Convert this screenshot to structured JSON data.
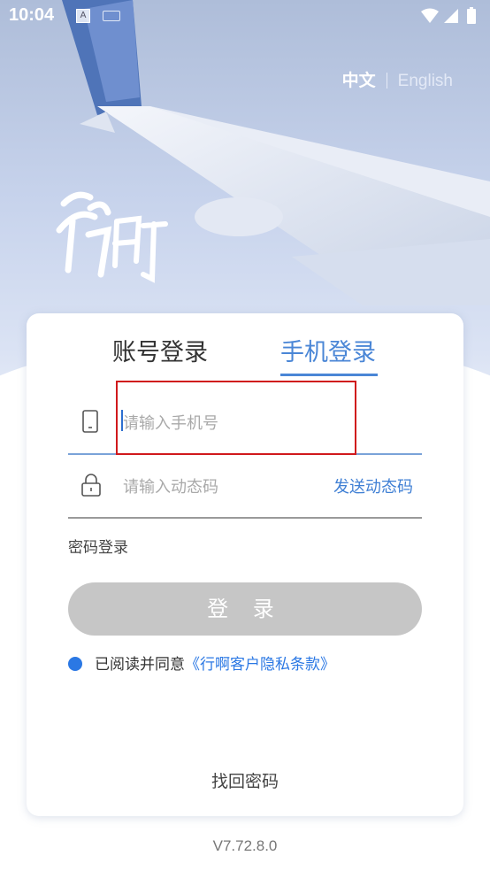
{
  "status_bar": {
    "time": "10:04"
  },
  "brand": {
    "logo_text": "行啊"
  },
  "language": {
    "chinese": "中文",
    "english": "English"
  },
  "tabs": {
    "account_login": "账号登录",
    "phone_login": "手机登录"
  },
  "phone_field": {
    "placeholder": "请输入手机号"
  },
  "code_field": {
    "placeholder": "请输入动态码",
    "send_code": "发送动态码"
  },
  "password_login": "密码登录",
  "login_button": "登 录",
  "agreement": {
    "prefix": "已阅读并同意",
    "link": "《行啊客户隐私条款》"
  },
  "forgot_password": "找回密码",
  "version": "V7.72.8.0",
  "colors": {
    "accent": "#4a86d6",
    "link": "#2b78e4",
    "button_disabled": "#c6c6c6",
    "highlight": "#d0191c"
  }
}
